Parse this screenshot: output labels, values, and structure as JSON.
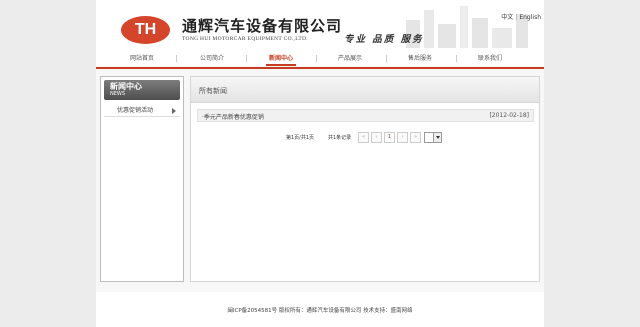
{
  "header": {
    "logo_text": "TH",
    "company_cn": "通辉汽车设备有限公司",
    "company_en": "TONG HUI MOTORCAR EQUIPMENT CO.,LTD.",
    "slogan": "专业 品质 服务",
    "lang_cn": "中文",
    "lang_sep": "|",
    "lang_en": "English"
  },
  "nav": {
    "items": [
      {
        "label": "网站首页"
      },
      {
        "label": "公司简介"
      },
      {
        "label": "新闻中心"
      },
      {
        "label": "产品展示"
      },
      {
        "label": "售后服务"
      },
      {
        "label": "联系我们"
      }
    ],
    "active_index": 2
  },
  "sidebar": {
    "title": "新闻中心",
    "subtitle": "NEWS",
    "items": [
      {
        "label": "优惠促销活动"
      }
    ]
  },
  "main": {
    "title": "所有新闻",
    "news": [
      {
        "title": "·季元产品新春优惠促销",
        "date": "[2012-02-18]"
      }
    ]
  },
  "pager": {
    "page_info": "第1页/共1页",
    "record_info": "共1条记录",
    "buttons": [
      "«",
      "‹",
      "1",
      "›",
      "»"
    ],
    "current": "1"
  },
  "footer": {
    "text": "闽ICP备2054581号 版权所有：通辉汽车设备有限公司 技术支持：盛南网络"
  },
  "colors": {
    "accent": "#c63b1e",
    "logo": "#d5452b"
  }
}
